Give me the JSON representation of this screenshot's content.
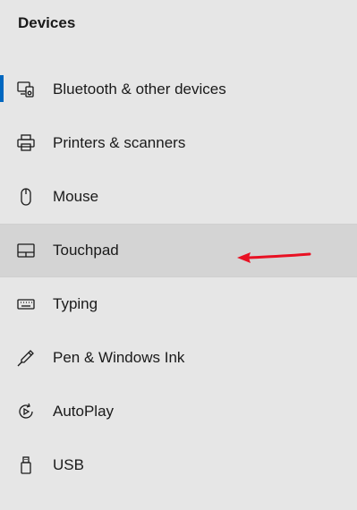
{
  "section": {
    "title": "Devices"
  },
  "nav": {
    "items": [
      {
        "label": "Bluetooth & other devices",
        "icon": "bluetooth-devices-icon",
        "selected": true
      },
      {
        "label": "Printers & scanners",
        "icon": "printer-icon"
      },
      {
        "label": "Mouse",
        "icon": "mouse-icon"
      },
      {
        "label": "Touchpad",
        "icon": "touchpad-icon",
        "hovered": true
      },
      {
        "label": "Typing",
        "icon": "keyboard-icon"
      },
      {
        "label": "Pen & Windows Ink",
        "icon": "pen-icon"
      },
      {
        "label": "AutoPlay",
        "icon": "autoplay-icon"
      },
      {
        "label": "USB",
        "icon": "usb-icon"
      }
    ]
  },
  "colors": {
    "background": "#e6e6e6",
    "hover": "#d4d4d4",
    "accent": "#0067c0",
    "annotation": "#e81123"
  }
}
